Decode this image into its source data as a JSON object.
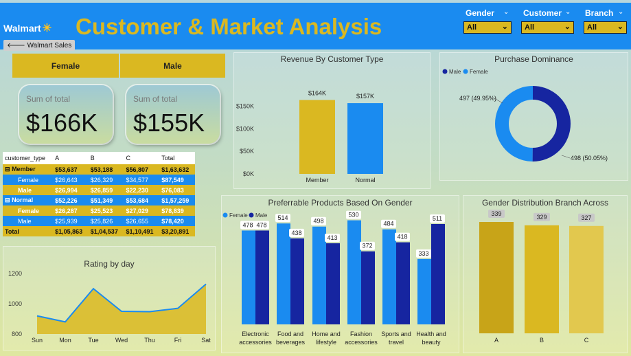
{
  "header": {
    "logo": "Walmart",
    "title": "Customer & Market Analysis",
    "back_button": "Walmart Sales",
    "filters": [
      {
        "label": "Gender",
        "value": "All"
      },
      {
        "label": "Customer",
        "value": "All"
      },
      {
        "label": "Branch",
        "value": "All"
      }
    ]
  },
  "gender_header": {
    "female": "Female",
    "male": "Male"
  },
  "cards": [
    {
      "label": "Sum of total",
      "value": "$166K"
    },
    {
      "label": "Sum of total",
      "value": "$155K"
    }
  ],
  "colors": {
    "blue": "#1a8bf0",
    "navy": "#1625a0",
    "gold": "#dab821"
  },
  "matrix": {
    "columns": [
      "customer_type",
      "A",
      "B",
      "C",
      "Total"
    ],
    "rows": [
      {
        "kind": "group",
        "label": "Member",
        "values": [
          "$53,637",
          "$53,188",
          "$56,807",
          "$1,63,632"
        ]
      },
      {
        "kind": "sub-blue",
        "label": "Female",
        "values": [
          "$26,643",
          "$26,329",
          "$34,577",
          "$87,549"
        ]
      },
      {
        "kind": "sub-yellow",
        "label": "Male",
        "values": [
          "$26,994",
          "$26,859",
          "$22,230",
          "$76,083"
        ]
      },
      {
        "kind": "group",
        "label": "Normal",
        "values": [
          "$52,226",
          "$51,349",
          "$53,684",
          "$1,57,259"
        ]
      },
      {
        "kind": "sub-yellow",
        "label": "Female",
        "values": [
          "$26,287",
          "$25,523",
          "$27,029",
          "$78,839"
        ]
      },
      {
        "kind": "sub-blue",
        "label": "Male",
        "values": [
          "$25,939",
          "$25,826",
          "$26,655",
          "$78,420"
        ]
      },
      {
        "kind": "total",
        "label": "Total",
        "values": [
          "$1,05,863",
          "$1,04,537",
          "$1,10,491",
          "$3,20,891"
        ]
      }
    ]
  },
  "chart_data": [
    {
      "id": "revenue",
      "type": "bar",
      "title": "Revenue By Customer Type",
      "categories": [
        "Member",
        "Normal"
      ],
      "values": [
        164,
        157
      ],
      "data_labels": [
        "$164K",
        "$157K"
      ],
      "colors": [
        "#dab821",
        "#1a8bf0"
      ],
      "yticks": [
        "$0K",
        "$50K",
        "$100K",
        "$150K"
      ],
      "ylim": [
        0,
        180
      ]
    },
    {
      "id": "dominance",
      "type": "pie",
      "title": "Purchase Dominance",
      "legend": [
        "Male",
        "Female"
      ],
      "values": [
        498,
        497
      ],
      "labels": [
        "498 (50.05%)",
        "497 (49.95%)"
      ],
      "colors": [
        "#1625a0",
        "#1a8bf0"
      ]
    },
    {
      "id": "products",
      "type": "bar",
      "title": "Preferrable Products Based On Gender",
      "legend": [
        "Female",
        "Male"
      ],
      "categories": [
        "Electronic accessories",
        "Food and beverages",
        "Home and lifestyle",
        "Fashion accessories",
        "Sports and travel",
        "Health and beauty"
      ],
      "category_lines": [
        [
          "Electronic",
          "accessories"
        ],
        [
          "Food and",
          "beverages"
        ],
        [
          "Home and",
          "lifestyle"
        ],
        [
          "Fashion",
          "accessories"
        ],
        [
          "Sports and",
          "travel"
        ],
        [
          "Health and",
          "beauty"
        ]
      ],
      "series": [
        {
          "name": "Female",
          "values": [
            478,
            514,
            498,
            530,
            484,
            333
          ]
        },
        {
          "name": "Male",
          "values": [
            478,
            438,
            413,
            372,
            418,
            511
          ]
        }
      ],
      "ylim": [
        0,
        560
      ]
    },
    {
      "id": "branch",
      "type": "bar",
      "title": "Gender Distribution Branch Across",
      "categories": [
        "A",
        "B",
        "C"
      ],
      "values": [
        339,
        329,
        327
      ],
      "colors": [
        "#c8a418",
        "#dab821",
        "#e2c84e"
      ],
      "ylim": [
        0,
        360
      ]
    },
    {
      "id": "rating",
      "type": "area",
      "title": "Rating by day",
      "categories": [
        "Sun",
        "Mon",
        "Tue",
        "Wed",
        "Thu",
        "Fri",
        "Sat"
      ],
      "values": [
        920,
        880,
        1100,
        950,
        948,
        970,
        1130
      ],
      "yticks": [
        "800",
        "1000",
        "1200"
      ],
      "ylim": [
        800,
        1200
      ]
    }
  ]
}
